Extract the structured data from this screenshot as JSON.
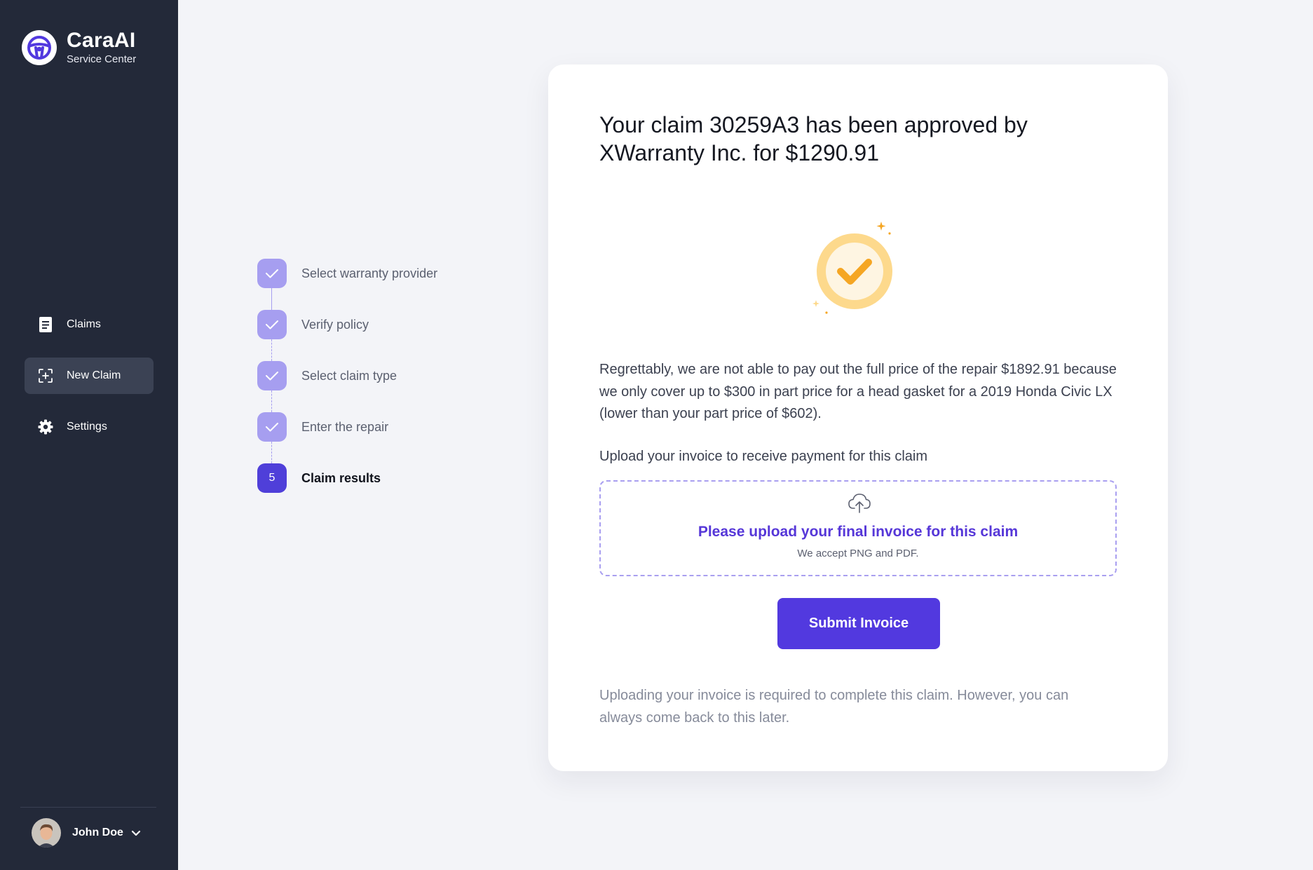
{
  "brand": {
    "name": "CaraAI",
    "subtitle": "Service Center",
    "logo_icon": "steering-wheel-icon"
  },
  "nav": {
    "items": [
      {
        "label": "Claims",
        "icon": "document-icon",
        "active": false
      },
      {
        "label": "New Claim",
        "icon": "scan-frame-icon",
        "active": true
      },
      {
        "label": "Settings",
        "icon": "gear-icon",
        "active": false
      }
    ]
  },
  "user": {
    "name": "John Doe",
    "icon": "chevron-down-icon"
  },
  "steps": [
    {
      "label": "Select warranty provider",
      "status": "complete"
    },
    {
      "label": "Verify policy",
      "status": "complete"
    },
    {
      "label": "Select claim type",
      "status": "complete"
    },
    {
      "label": "Enter the repair",
      "status": "complete"
    },
    {
      "number": "5",
      "label": "Claim results",
      "status": "current"
    }
  ],
  "card": {
    "title": "Your claim 30259A3 has been approved by XWarranty Inc. for $1290.91",
    "body": "Regrettably, we are not able to pay out the full price of the repair $1892.91 because we only cover up to $300 in part price for a head gasket for a 2019 Honda Civic LX (lower than your part price of $602).",
    "upload_label": "Upload your invoice to receive payment for this claim",
    "dropzone": {
      "title": "Please upload your final invoice for this claim",
      "subtitle": "We accept PNG and PDF.",
      "icon": "cloud-upload-icon"
    },
    "submit_label": "Submit Invoice",
    "footnote": "Uploading your invoice is required to complete this claim. However, you can always come back to this later."
  },
  "colors": {
    "sidebar_bg": "#232939",
    "accent": "#5239df",
    "step_complete": "#a69ef0",
    "badge_ring": "#fdd98c",
    "badge_check": "#f5a623"
  }
}
